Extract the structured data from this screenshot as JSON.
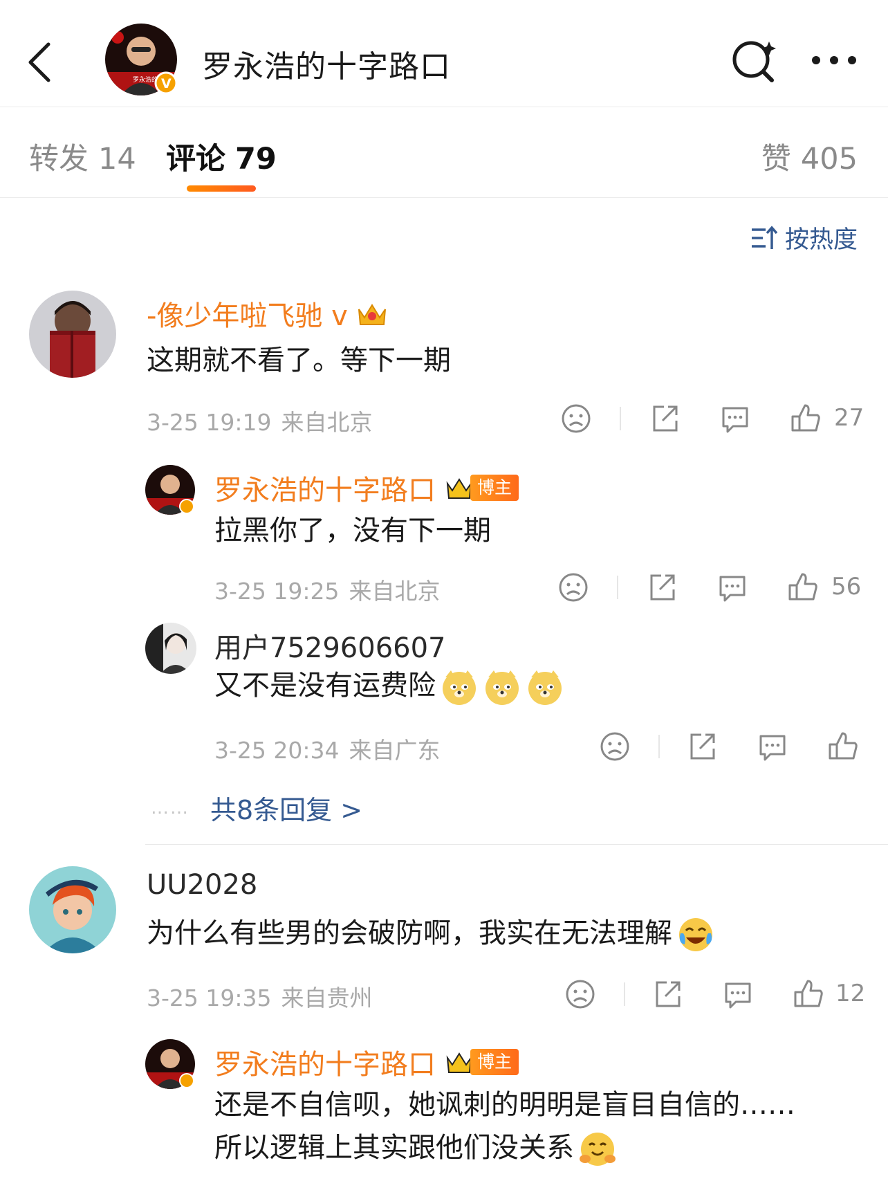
{
  "header": {
    "title": "罗永浩的十字路口",
    "back_icon": "back-arrow-icon",
    "search_icon": "search-icon",
    "more_icon": "more-icon",
    "avatar_caption": "罗永浩的十字路"
  },
  "tabs": {
    "repost": {
      "label": "转发",
      "count": "14"
    },
    "comment": {
      "label": "评论",
      "count": "79"
    },
    "like": {
      "label": "赞",
      "count": "405"
    }
  },
  "sort": {
    "label": "按热度",
    "icon": "sort-icon"
  },
  "comments": [
    {
      "name": "-像少年啦飞驰 v",
      "text": "这期就不看了。等下一期",
      "date": "3-25 19:19",
      "location": "来自北京",
      "likes": "27"
    },
    {
      "name": "UU2028",
      "text": "为什么有些男的会破防啊，我实在无法理解",
      "date": "3-25 19:35",
      "location": "来自贵州",
      "likes": "12"
    }
  ],
  "replies": [
    {
      "name": "罗永浩的十字路口",
      "badge": "博主",
      "text": "拉黑你了，没有下一期",
      "date": "3-25 19:25",
      "location": "来自北京",
      "likes": "56"
    },
    {
      "name": "用户7529606607",
      "text": "又不是没有运费险",
      "date": "3-25 20:34",
      "location": "来自广东",
      "likes": ""
    },
    {
      "name": "罗永浩的十字路口",
      "badge": "博主",
      "text_line1": "还是不自信呗，她讽刺的明明是盲目自信的……",
      "text_line2": "所以逻辑上其实跟他们没关系"
    }
  ],
  "more_replies": {
    "dots": "……",
    "label": "共8条回复 >"
  },
  "colors": {
    "accent": "#f27d1e",
    "link": "#355a91",
    "tab_underline": "#ff6a1a"
  }
}
